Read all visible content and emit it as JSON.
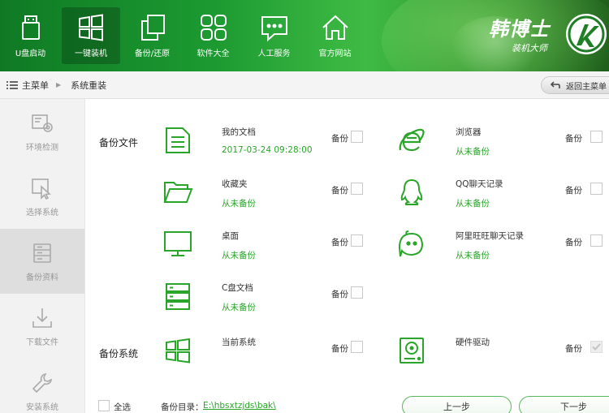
{
  "header": {
    "nav": [
      {
        "label": "U盘启动",
        "icon": "usb-icon"
      },
      {
        "label": "一键装机",
        "icon": "windows-icon"
      },
      {
        "label": "备份/还原",
        "icon": "backup-restore-icon"
      },
      {
        "label": "软件大全",
        "icon": "apps-grid-icon"
      },
      {
        "label": "人工服务",
        "icon": "chat-icon"
      },
      {
        "label": "官方网站",
        "icon": "home-icon"
      }
    ],
    "brand_name": "韩博士",
    "brand_sub": "装机大师"
  },
  "breadcrumb": {
    "root": "主菜单",
    "current": "系统重装",
    "back_label": "返回主菜单"
  },
  "sidebar": [
    {
      "label": "环境检测",
      "icon": "pc-gear-icon"
    },
    {
      "label": "选择系统",
      "icon": "select-cursor-icon"
    },
    {
      "label": "备份资料",
      "icon": "storage-icon",
      "active": true
    },
    {
      "label": "下载文件",
      "icon": "download-icon"
    },
    {
      "label": "安装系统",
      "icon": "wrench-icon"
    }
  ],
  "main": {
    "backup_files_label": "备份文件",
    "backup_system_label": "备份系统",
    "backup_word": "备份",
    "files_left": [
      {
        "name": "我的文档",
        "status": "2017-03-24 09:28:00",
        "icon": "document-icon"
      },
      {
        "name": "收藏夹",
        "status": "从未备份",
        "icon": "folder-icon"
      },
      {
        "name": "桌面",
        "status": "从未备份",
        "icon": "monitor-icon"
      },
      {
        "name": "C盘文档",
        "status": "从未备份",
        "icon": "server-icon"
      }
    ],
    "files_right": [
      {
        "name": "浏览器",
        "status": "从未备份",
        "icon": "ie-browser-icon"
      },
      {
        "name": "QQ聊天记录",
        "status": "从未备份",
        "icon": "qq-icon"
      },
      {
        "name": "阿里旺旺聊天记录",
        "status": "从未备份",
        "icon": "aliwangwang-icon"
      }
    ],
    "system_left": {
      "name": "当前系统",
      "icon": "windows-logo-icon"
    },
    "system_right": {
      "name": "硬件驱动",
      "icon": "hard-drive-icon",
      "checked": true,
      "disabled": true
    }
  },
  "footer": {
    "select_all": "全选",
    "dir_label": "备份目录：",
    "dir_value": "E:\\hbsxtzjds\\bak\\",
    "prev_label": "上一步",
    "next_label": "下一步"
  },
  "colors": {
    "accent_green": "#2aa52a",
    "header_green": "#1c9a31"
  }
}
